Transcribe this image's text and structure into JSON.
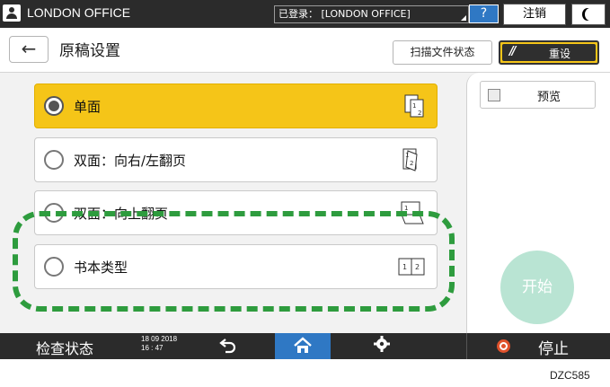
{
  "topbar": {
    "office_name": "LONDON OFFICE",
    "login_status": "已登录： [LONDON OFFICE]",
    "help_label": "?",
    "logout_label": "注销",
    "eco_icon": "moon-icon"
  },
  "header": {
    "back_icon": "←",
    "title": "原稿设置",
    "scan_status_label": "扫描文件状态",
    "reset_label": "重设"
  },
  "options": [
    {
      "label": "单面",
      "selected": true,
      "icon": "one-sided-icon"
    },
    {
      "label": "双面：向右/左翻页",
      "selected": false,
      "icon": "two-sided-left-right-icon"
    },
    {
      "label": "双面：向上翻页",
      "selected": false,
      "icon": "two-sided-top-icon"
    },
    {
      "label": "书本类型",
      "selected": false,
      "icon": "book-type-icon"
    }
  ],
  "right_panel": {
    "preview_label": "预览",
    "start_label": "开始"
  },
  "bottombar": {
    "check_status_label": "检查状态",
    "date": "18 09 2018",
    "time": "16 : 47",
    "stop_label": "停止"
  },
  "figure_code": "DZC585",
  "colors": {
    "selected_option": "#f5c518",
    "highlight": "#2e9c3e",
    "start_button": "#b9e4d3",
    "home_active": "#2f78c4"
  }
}
